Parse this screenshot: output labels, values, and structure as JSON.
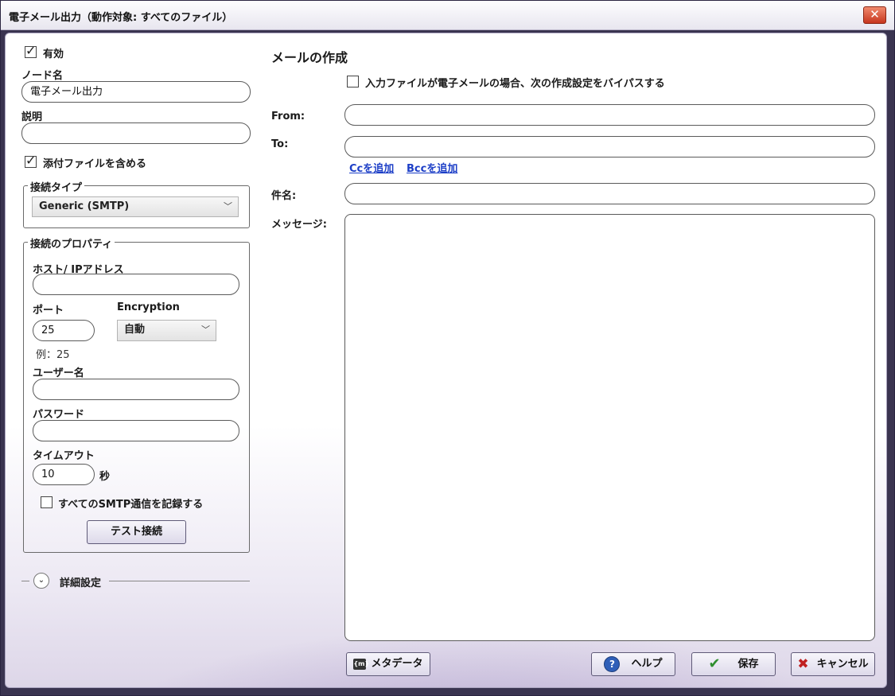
{
  "window": {
    "title": "電子メール出力（動作対象: すべてのファイル）",
    "close_glyph": "✕"
  },
  "left": {
    "enabled_label": "有効",
    "enabled_checked": true,
    "node_name_label": "ノード名",
    "node_name_value": "電子メール出力",
    "description_label": "説明",
    "description_value": "",
    "include_attachments_label": "添付ファイルを含める",
    "include_attachments_checked": true,
    "connection_type": {
      "legend": "接続タイプ",
      "selected": "Generic (SMTP)"
    },
    "connection_props": {
      "legend": "接続のプロパティ",
      "host_label": "ホスト/ IPアドレス",
      "host_value": "",
      "port_label": "ポート",
      "port_value": "25",
      "port_hint": "例：25",
      "encryption_label": "Encryption",
      "encryption_selected": "自動",
      "username_label": "ユーザー名",
      "username_value": "",
      "password_label": "パスワード",
      "password_value": "",
      "timeout_label": "タイムアウト",
      "timeout_value": "10",
      "timeout_unit": "秒",
      "log_smtp_label": "すべてのSMTP通信を記録する",
      "log_smtp_checked": false,
      "test_button": "テスト接続"
    },
    "advanced_label": "詳細設定"
  },
  "compose": {
    "heading": "メールの作成",
    "bypass_label": "入力ファイルが電子メールの場合、次の作成設定をバイパスする",
    "bypass_checked": false,
    "from_label": "From:",
    "from_value": "",
    "to_label": "To:",
    "to_value": "",
    "add_cc": "Ccを追加",
    "add_bcc": "Bccを追加",
    "subject_label": "件名:",
    "subject_value": "",
    "message_label": "メッセージ:",
    "message_value": ""
  },
  "footer": {
    "metadata_button": "メタデータ",
    "help_button": "ヘルプ",
    "save_button": "保存",
    "cancel_button": "キャンセル"
  },
  "colors": {
    "link": "#1d3fc7",
    "save_check": "#2f8f2f",
    "cancel_x": "#c02020",
    "help_icon": "#2f5fb8"
  }
}
